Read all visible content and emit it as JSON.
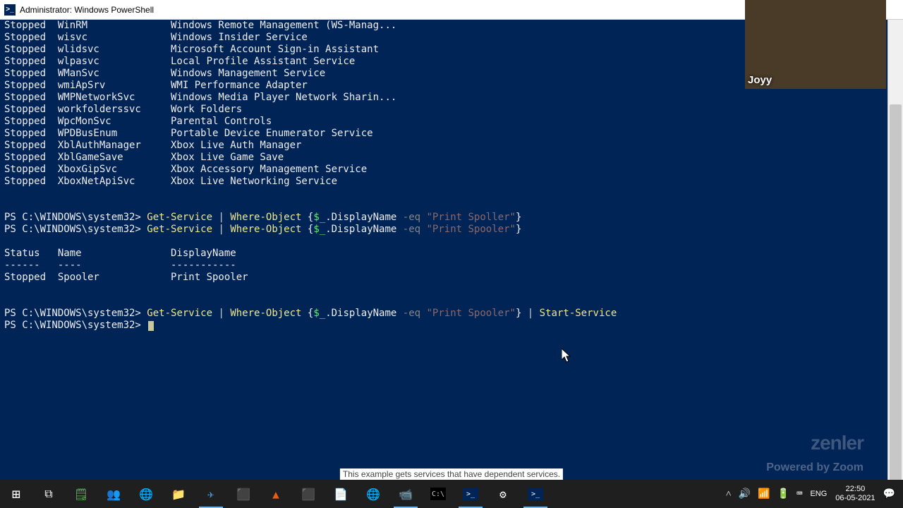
{
  "window": {
    "title": "Administrator: Windows PowerShell"
  },
  "webcam": {
    "name": "Joyy"
  },
  "watermark": {
    "brand": "zenler",
    "powered": "Powered by Zoom"
  },
  "hidden_hint": "This example gets services that have dependent services.",
  "services": [
    {
      "status": "Stopped",
      "name": "WinRM",
      "display": "Windows Remote Management (WS-Manag..."
    },
    {
      "status": "Stopped",
      "name": "wisvc",
      "display": "Windows Insider Service"
    },
    {
      "status": "Stopped",
      "name": "wlidsvc",
      "display": "Microsoft Account Sign-in Assistant"
    },
    {
      "status": "Stopped",
      "name": "wlpasvc",
      "display": "Local Profile Assistant Service"
    },
    {
      "status": "Stopped",
      "name": "WManSvc",
      "display": "Windows Management Service"
    },
    {
      "status": "Stopped",
      "name": "wmiApSrv",
      "display": "WMI Performance Adapter"
    },
    {
      "status": "Stopped",
      "name": "WMPNetworkSvc",
      "display": "Windows Media Player Network Sharin..."
    },
    {
      "status": "Stopped",
      "name": "workfolderssvc",
      "display": "Work Folders"
    },
    {
      "status": "Stopped",
      "name": "WpcMonSvc",
      "display": "Parental Controls"
    },
    {
      "status": "Stopped",
      "name": "WPDBusEnum",
      "display": "Portable Device Enumerator Service"
    },
    {
      "status": "Stopped",
      "name": "XblAuthManager",
      "display": "Xbox Live Auth Manager"
    },
    {
      "status": "Stopped",
      "name": "XblGameSave",
      "display": "Xbox Live Game Save"
    },
    {
      "status": "Stopped",
      "name": "XboxGipSvc",
      "display": "Xbox Accessory Management Service"
    },
    {
      "status": "Stopped",
      "name": "XboxNetApiSvc",
      "display": "Xbox Live Networking Service"
    }
  ],
  "prompt": "PS C:\\WINDOWS\\system32>",
  "cmd1": {
    "ps": "PS C:\\WINDOWS\\system32> ",
    "a": "Get-Service",
    "p1": " | ",
    "b": "Where-Object",
    "brace_open": " {",
    "var": "$_",
    "prop": ".DisplayName ",
    "op": "-eq",
    "sp": " ",
    "str": "\"Print Spoller\"",
    "brace_close": "}"
  },
  "cmd2": {
    "ps": "PS C:\\WINDOWS\\system32> ",
    "a": "Get-Service",
    "p1": " | ",
    "b": "Where-Object",
    "brace_open": " {",
    "var": "$_",
    "prop": ".DisplayName ",
    "op": "-eq",
    "sp": " ",
    "str": "\"Print Spooler\"",
    "brace_close": "}"
  },
  "table": {
    "header": "Status   Name               DisplayName",
    "divider": "------   ----               -----------",
    "row": "Stopped  Spooler            Print Spooler"
  },
  "cmd3": {
    "ps": "PS C:\\WINDOWS\\system32> ",
    "a": "Get-Service",
    "p1": " | ",
    "b": "Where-Object",
    "brace_open": " {",
    "var": "$_",
    "prop": ".DisplayName ",
    "op": "-eq",
    "sp": " ",
    "str": "\"Print Spooler\"",
    "brace_close": "}",
    "p2": " | ",
    "c": "Start-Service"
  },
  "tray": {
    "lang": "ENG",
    "time": "22:50",
    "date": "06-05-2021"
  }
}
